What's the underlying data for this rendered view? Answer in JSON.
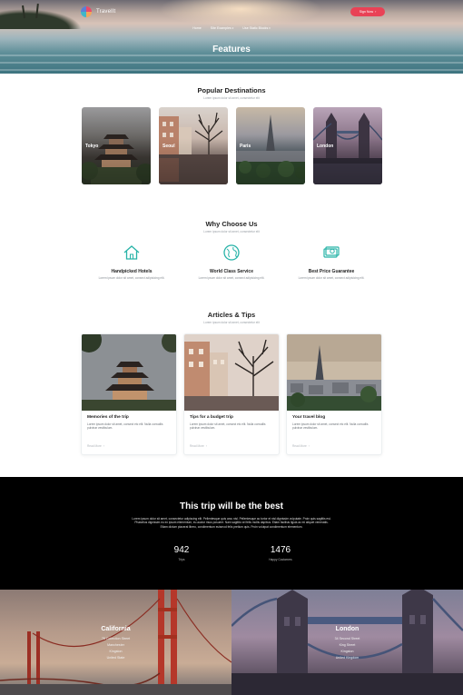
{
  "brand": {
    "name": "TravelIt",
    "accent": "#e94256"
  },
  "nav": {
    "items": [
      {
        "label": "Home",
        "caret": false
      },
      {
        "label": "Site Examples",
        "caret": true
      },
      {
        "label": "Use Static Blocks",
        "caret": true
      }
    ],
    "signup_label": "Sign Now",
    "signup_icon": "chevron-right-icon"
  },
  "hero": {
    "title": "Features"
  },
  "destinations": {
    "title": "Popular Destinations",
    "subtitle": "Lorem ipsum dolor sit amet, consectetur elit",
    "items": [
      {
        "name": "Tokyo"
      },
      {
        "name": "Seoul"
      },
      {
        "name": "Paris"
      },
      {
        "name": "London"
      }
    ]
  },
  "why": {
    "title": "Why Choose Us",
    "subtitle": "Lorem ipsum dolor sit amet, consectetur elit",
    "features": [
      {
        "icon": "home-icon",
        "title": "Handpicked Hotels",
        "desc": "Lorem ipsum dolor sit amet, consect adipisicing elit."
      },
      {
        "icon": "globe-icon",
        "title": "World Class Service",
        "desc": "Lorem ipsum dolor sit amet, consect adipisicing elit."
      },
      {
        "icon": "money-icon",
        "title": "Best Price Guarantee",
        "desc": "Lorem ipsum dolor sit amet, consect adipisicing elit."
      }
    ]
  },
  "articles": {
    "title": "Articles & Tips",
    "subtitle": "Lorem ipsum dolor sit amet, consectetur elit",
    "items": [
      {
        "title": "Memories of the trip",
        "text": "Lorem ipsum dolor sit amet, consect etc elit. Nulla convallis pulvinar vestibulum.",
        "more": "Read More"
      },
      {
        "title": "Tips for a budget trip",
        "text": "Lorem ipsum dolor sit amet, consect etc elit. Nulla convallis pulvinar vestibulum.",
        "more": "Read More"
      },
      {
        "title": "Your travel blog",
        "text": "Lorem ipsum dolor sit amet, consect etc elit. Nulla convallis pulvinar vestibulum.",
        "more": "Read More"
      }
    ]
  },
  "stats": {
    "title": "This trip will be the best",
    "text": "Lorem ipsum dolor sit amet, consectetur adipiscing elit. Pellentesque quis arcu nisl. Pellentesque ac tortor et nisl dignissim vulputate. Proin quis sagittis est. Phasellus dignissim eu ex ipsum elementum, eu auctor risus posuere. Nam sagittis vel felis mollis dapibus. Etiam facilisis ligula ac mi aliquet venenatis. Etiam dictum placerat libero, condimentum euismod felis pretium quis. Proin volutpat condimentum elementum.",
    "items": [
      {
        "number": "942",
        "label": "Trips"
      },
      {
        "number": "1476",
        "label": "Happy Customers"
      }
    ]
  },
  "locations": [
    {
      "name": "California",
      "lines": [
        "78 Collection Street",
        "Manchester",
        "Kingston",
        "United State"
      ]
    },
    {
      "name": "London",
      "lines": [
        "34 Second Street",
        "King Street",
        "Kingston",
        "United Kingdom"
      ]
    }
  ]
}
